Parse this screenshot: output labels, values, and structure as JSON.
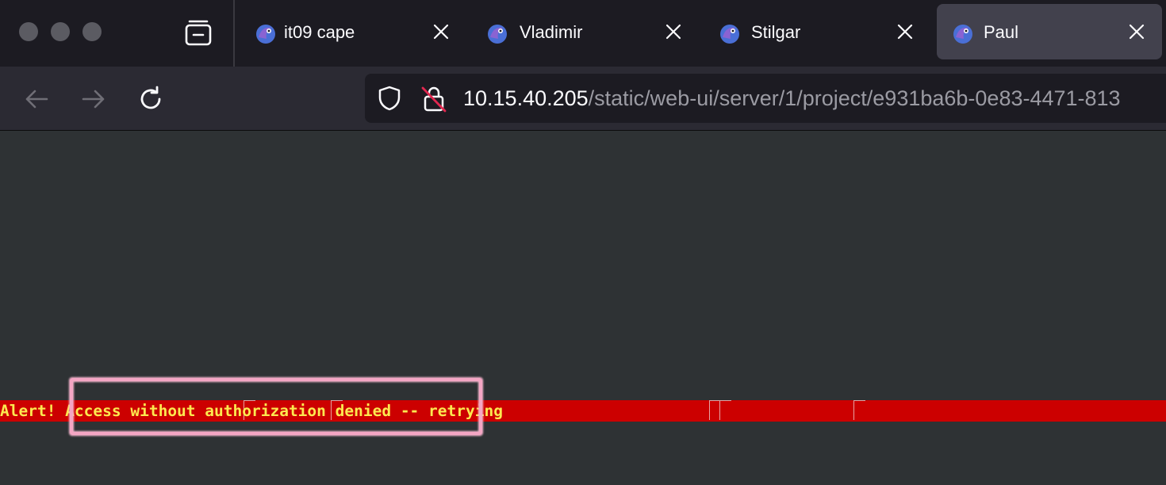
{
  "window": {
    "tabs": [
      {
        "label": "it09 cape",
        "active": false
      },
      {
        "label": "Vladimir",
        "active": false
      },
      {
        "label": "Stilgar",
        "active": false
      },
      {
        "label": "Paul",
        "active": true
      }
    ]
  },
  "toolbar": {
    "back_icon": "arrow-left-icon",
    "forward_icon": "arrow-right-icon",
    "reload_icon": "reload-icon"
  },
  "url": {
    "host": "10.15.40.205",
    "path": "/static/web-ui/server/1/project/e931ba6b-0e83-4471-813",
    "security_icons": [
      "shield-icon",
      "insecure-lock-icon"
    ]
  },
  "terminal": {
    "alert_line": "Alert! Access without authorization denied -- retrying"
  },
  "colors": {
    "tabbar_bg": "#1c1b22",
    "navbar_bg": "#2b2a33",
    "content_bg": "#2e3234",
    "alert_bg": "#cc0000",
    "alert_text": "#fce94f",
    "highlight": "#f4a6c4"
  }
}
